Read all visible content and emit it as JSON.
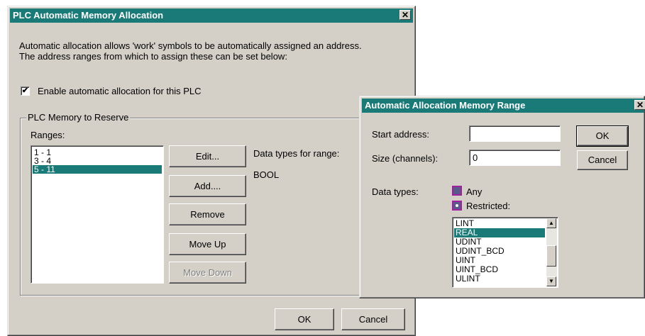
{
  "main_dialog": {
    "title": "PLC Automatic Memory Allocation",
    "close_glyph": "✕",
    "description_line1": "Automatic allocation allows 'work' symbols to be automatically assigned an address.",
    "description_line2": "The address ranges from which to assign these can be set below:",
    "enable_checkbox": {
      "label": "Enable automatic allocation for this PLC",
      "checked": true,
      "mark": "✔"
    },
    "group_title": "PLC Memory to Reserve",
    "ranges_label": "Ranges:",
    "ranges": [
      "1 - 1",
      "3 - 4",
      "5 - 11"
    ],
    "selected_range": "5 - 11",
    "buttons": {
      "edit": "Edit...",
      "add": "Add....",
      "remove": "Remove",
      "move_up": "Move Up",
      "move_down": "Move Down"
    },
    "data_types_label": "Data types for range:",
    "data_types_value": "BOOL",
    "ok": "OK",
    "cancel": "Cancel"
  },
  "range_dialog": {
    "title": "Automatic Allocation Memory Range",
    "close_glyph": "✕",
    "start_address_label": "Start address:",
    "start_address_value": "",
    "size_label": "Size (channels):",
    "size_value": "0",
    "data_types_label": "Data types:",
    "radio_any": "Any",
    "radio_restricted": "Restricted:",
    "selected_radio": "Restricted:",
    "type_list": [
      "LINT",
      "REAL",
      "UDINT",
      "UDINT_BCD",
      "UINT",
      "UINT_BCD",
      "ULINT"
    ],
    "selected_type": "REAL",
    "ok": "OK",
    "cancel": "Cancel",
    "scroll_up_glyph": "▲",
    "scroll_down_glyph": "▼"
  },
  "colors": {
    "titlebar": "#1a7a78",
    "face": "#d4d0c8",
    "selection": "#1a7a78"
  }
}
